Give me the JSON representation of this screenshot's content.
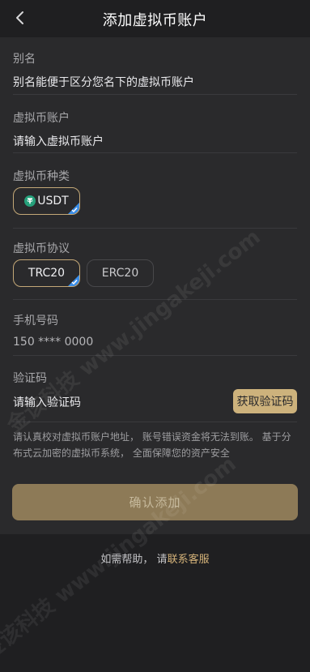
{
  "header": {
    "title": "添加虚拟币账户"
  },
  "alias": {
    "label": "别名",
    "value": "别名能便于区分您名下的虚拟币账户"
  },
  "account": {
    "label": "虚拟币账户",
    "placeholder": "请输入虚拟币账户"
  },
  "coin_type": {
    "label": "虚拟币种类",
    "options": [
      {
        "label": "USDT",
        "selected": true,
        "icon": "tether-icon"
      }
    ]
  },
  "protocol": {
    "label": "虚拟币协议",
    "options": [
      {
        "label": "TRC20",
        "selected": true
      },
      {
        "label": "ERC20",
        "selected": false
      }
    ]
  },
  "phone": {
    "label": "手机号码",
    "value": "150 **** 0000"
  },
  "verification": {
    "label": "验证码",
    "placeholder": "请输入验证码",
    "get_code_label": "获取验证码"
  },
  "notice": "请认真校对虚拟币账户地址， 账号错误资金将无法到账。 基于分布式云加密的虚拟币系统， 全面保障您的资产安全",
  "confirm_label": "确认添加",
  "help": {
    "prefix": "如需帮助，  请",
    "link": "联系客服"
  },
  "watermark": "金该科技 www.jingakeji.com",
  "colors": {
    "accent": "#cdb27c",
    "selected_corner": "#3b8fea",
    "background": "#2a2a2c",
    "usdt": "#26a17b"
  }
}
